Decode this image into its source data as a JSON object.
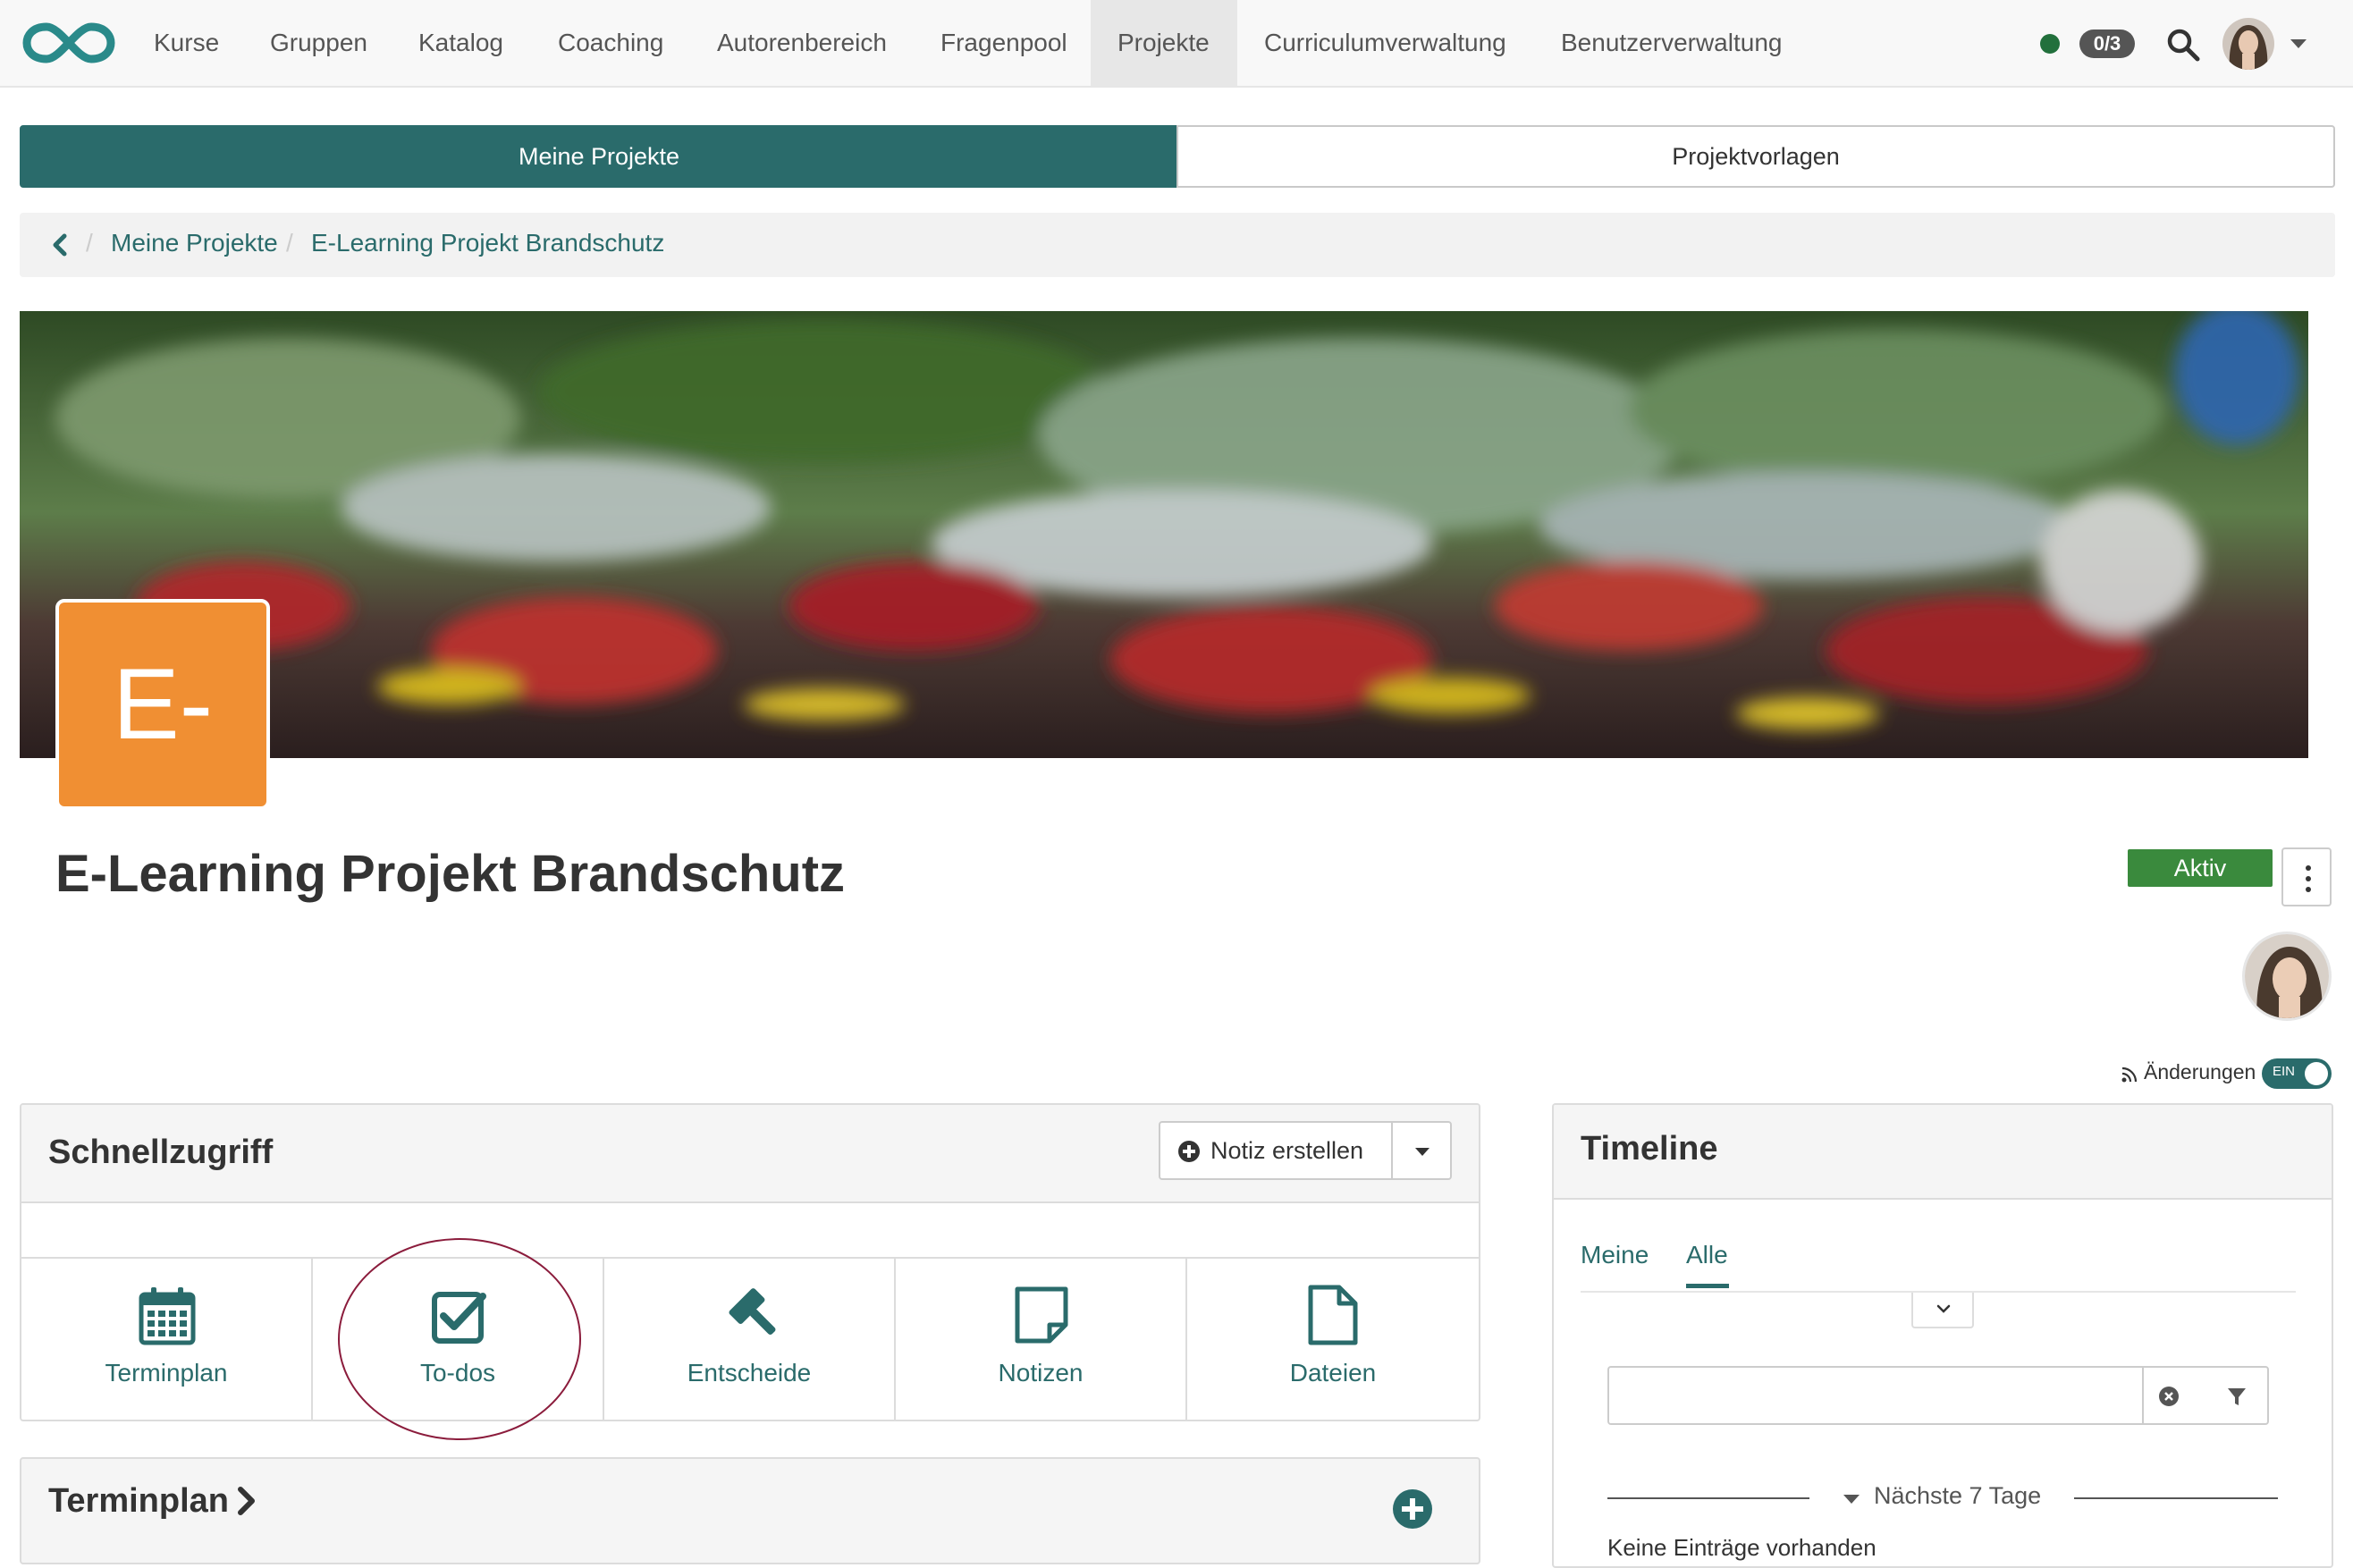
{
  "nav": {
    "items": [
      "Kurse",
      "Gruppen",
      "Katalog",
      "Coaching",
      "Autorenbereich",
      "Fragenpool",
      "Projekte",
      "Curriculumverwaltung",
      "Benutzerverwaltung"
    ],
    "active": "Projekte",
    "counter": "0/3",
    "status_color": "#22703c",
    "icons": [
      "openolat-logo-icon",
      "search-icon",
      "user-avatar",
      "caret-down-icon"
    ]
  },
  "tabs": {
    "my_projects": "Meine Projekte",
    "templates": "Projektvorlagen"
  },
  "breadcrumb": {
    "items": [
      "Meine Projekte",
      "E-Learning Projekt Brandschutz"
    ]
  },
  "project": {
    "logo_text": "E-",
    "logo_color": "#f08f33",
    "title": "E-Learning Projekt Brandschutz",
    "status": "Aktiv",
    "status_color": "#3a8a3d"
  },
  "changes": {
    "label": "Änderungen",
    "toggle": "EIN"
  },
  "quick_access": {
    "title": "Schnellzugriff",
    "create_note": "Notiz erstellen",
    "tiles": [
      "Terminplan",
      "To-dos",
      "Entscheide",
      "Notizen",
      "Dateien"
    ],
    "highlighted": "To-dos"
  },
  "terminplan": {
    "title": "Terminplan"
  },
  "timeline": {
    "title": "Timeline",
    "tabs": [
      "Meine",
      "Alle"
    ],
    "active_tab": "Alle",
    "section": "Nächste 7 Tage",
    "partial_text": "Keine Einträge vorhanden"
  },
  "accent_color": "#2a6b6b"
}
